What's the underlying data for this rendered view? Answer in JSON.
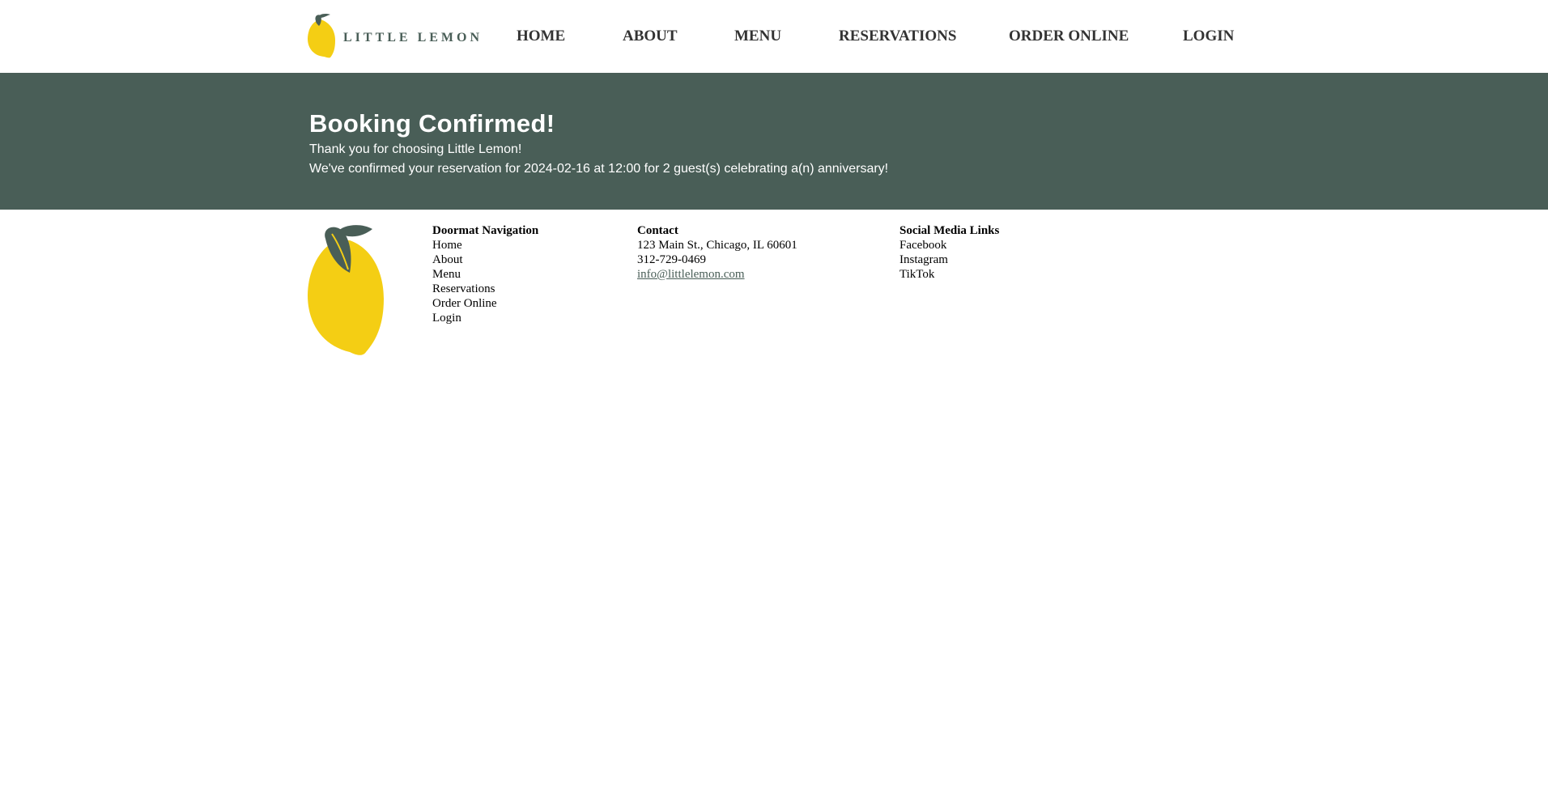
{
  "brand": {
    "name": "LITTLE LEMON",
    "colors": {
      "primary": "#495e57",
      "accent": "#f4ce14",
      "text": "#333333"
    }
  },
  "nav": {
    "items": [
      {
        "label": "HOME"
      },
      {
        "label": "ABOUT"
      },
      {
        "label": "MENU"
      },
      {
        "label": "RESERVATIONS"
      },
      {
        "label": "ORDER ONLINE"
      },
      {
        "label": "LOGIN"
      }
    ]
  },
  "confirmation": {
    "heading": "Booking Confirmed!",
    "thanks": "Thank you for choosing Little Lemon!",
    "details": "We've confirmed your reservation for 2024-02-16 at 12:00 for 2 guest(s) celebrating a(n) anniversary!"
  },
  "footer": {
    "doormat": {
      "heading": "Doormat Navigation",
      "links": [
        "Home",
        "About",
        "Menu",
        "Reservations",
        "Order Online",
        "Login"
      ]
    },
    "contact": {
      "heading": "Contact",
      "address": "123 Main St., Chicago, IL 60601",
      "phone": "312-729-0469",
      "email": "info@littlelemon.com"
    },
    "social": {
      "heading": "Social Media Links",
      "links": [
        "Facebook",
        "Instagram",
        "TikTok"
      ]
    }
  }
}
